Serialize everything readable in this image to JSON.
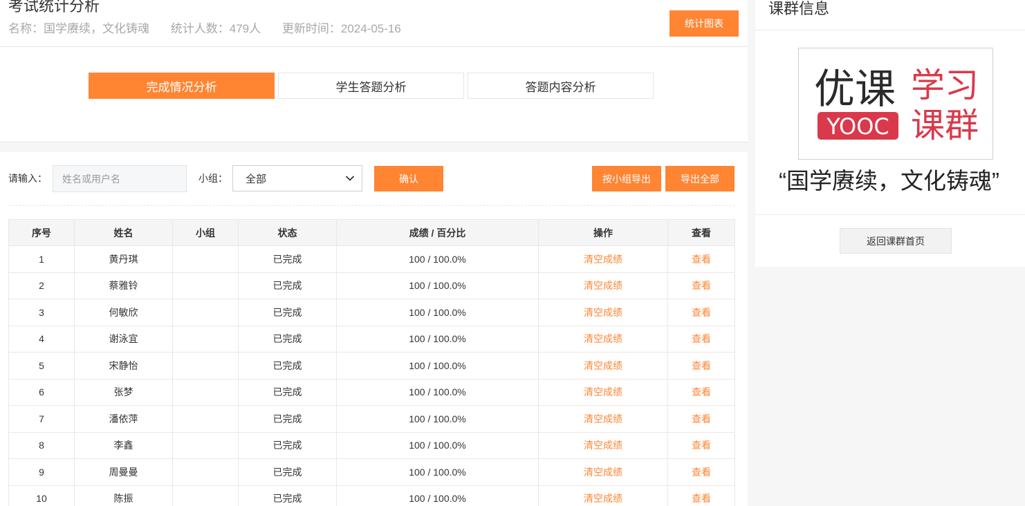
{
  "header": {
    "title": "考试统计分析",
    "name_label": "名称：国学赓续，文化铸魂",
    "count_label": "统计人数：479人",
    "updated_label": "更新时间：2024-05-16",
    "chart_button": "统计图表"
  },
  "tabs": [
    {
      "label": "完成情况分析",
      "active": true
    },
    {
      "label": "学生答题分析",
      "active": false
    },
    {
      "label": "答题内容分析",
      "active": false
    }
  ],
  "filters": {
    "input_label": "请输入：",
    "input_placeholder": "姓名或用户名",
    "input_value": "",
    "group_label": "小组：",
    "group_selected": "全部",
    "confirm_button": "确认",
    "export_group_button": "按小组导出",
    "export_all_button": "导出全部"
  },
  "table": {
    "headers": [
      "序号",
      "姓名",
      "小组",
      "状态",
      "成绩 / 百分比",
      "操作",
      "查看"
    ],
    "rows": [
      {
        "index": "1",
        "name": "黄丹琪",
        "group": "",
        "status": "已完成",
        "score": "100 / 100.0%",
        "action": "清空成绩",
        "view": "查看"
      },
      {
        "index": "2",
        "name": "蔡雅铃",
        "group": "",
        "status": "已完成",
        "score": "100 / 100.0%",
        "action": "清空成绩",
        "view": "查看"
      },
      {
        "index": "3",
        "name": "何敏欣",
        "group": "",
        "status": "已完成",
        "score": "100 / 100.0%",
        "action": "清空成绩",
        "view": "查看"
      },
      {
        "index": "4",
        "name": "谢泳宜",
        "group": "",
        "status": "已完成",
        "score": "100 / 100.0%",
        "action": "清空成绩",
        "view": "查看"
      },
      {
        "index": "5",
        "name": "宋静怡",
        "group": "",
        "status": "已完成",
        "score": "100 / 100.0%",
        "action": "清空成绩",
        "view": "查看"
      },
      {
        "index": "6",
        "name": "张梦",
        "group": "",
        "status": "已完成",
        "score": "100 / 100.0%",
        "action": "清空成绩",
        "view": "查看"
      },
      {
        "index": "7",
        "name": "潘依萍",
        "group": "",
        "status": "已完成",
        "score": "100 / 100.0%",
        "action": "清空成绩",
        "view": "查看"
      },
      {
        "index": "8",
        "name": "李鑫",
        "group": "",
        "status": "已完成",
        "score": "100 / 100.0%",
        "action": "清空成绩",
        "view": "查看"
      },
      {
        "index": "9",
        "name": "周曼曼",
        "group": "",
        "status": "已完成",
        "score": "100 / 100.0%",
        "action": "清空成绩",
        "view": "查看"
      },
      {
        "index": "10",
        "name": "陈振",
        "group": "",
        "status": "已完成",
        "score": "100 / 100.0%",
        "action": "清空成绩",
        "view": "查看"
      }
    ]
  },
  "sidebar": {
    "title": "课群信息",
    "logo": {
      "brand_cn": "优课",
      "brand_en": "YOOC",
      "slogan_1": "学习",
      "slogan_2": "课群"
    },
    "group_name": "“国学赓续，文化铸魂”",
    "back_button": "返回课群首页"
  },
  "colors": {
    "accent": "#ff8533",
    "brand_red": "#d9394b",
    "text": "#333333"
  },
  "icons": {
    "select_arrow": "chevron-down-icon"
  }
}
